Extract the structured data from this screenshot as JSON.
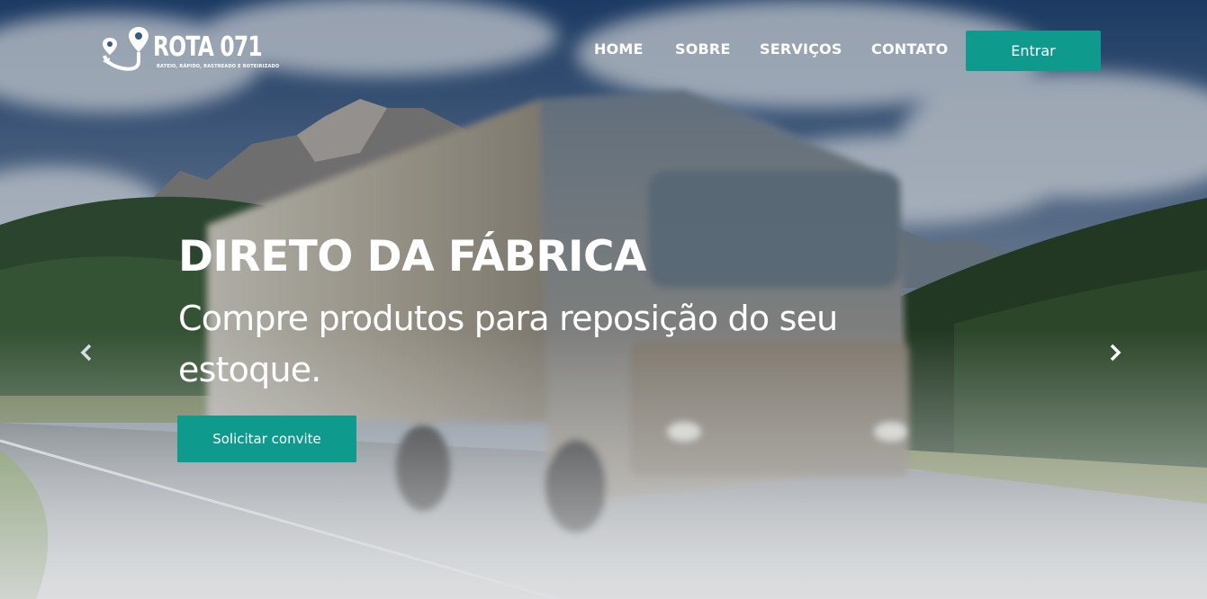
{
  "header": {
    "logo": {
      "name": "ROTA 071",
      "tagline": "RATEIO, RÁPIDO, RASTREADO E ROTEIRIZADO",
      "icon": "map-pin-anchor-icon"
    },
    "nav": {
      "items": [
        {
          "label": "HOME"
        },
        {
          "label": "SOBRE"
        },
        {
          "label": "SERVIÇOS"
        },
        {
          "label": "CONTATO"
        }
      ],
      "login_label": "Entrar"
    }
  },
  "hero": {
    "title": "DIRETO DA FÁBRICA",
    "subtitle": "Compre produtos para reposição do seu estoque.",
    "cta_label": "Solicitar convite",
    "background": "truck-on-mountain-road-photo",
    "prev_icon": "chevron-left-icon",
    "next_icon": "chevron-right-icon"
  },
  "colors": {
    "accent": "#0e9a8c",
    "text": "#ffffff",
    "sky": "#2f5a8a"
  }
}
